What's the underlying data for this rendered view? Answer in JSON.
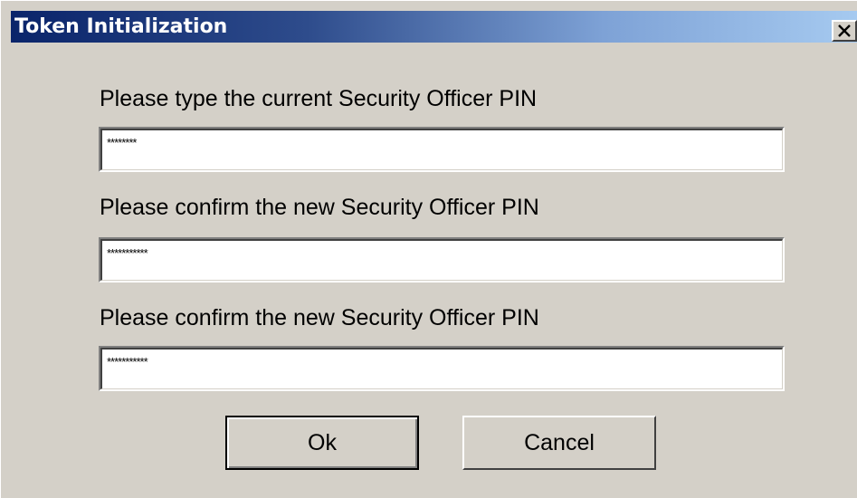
{
  "window": {
    "title": "Token Initialization",
    "close_label": "×"
  },
  "fields": [
    {
      "label": "Please type the current Security Officer PIN",
      "value": "********"
    },
    {
      "label": "Please confirm the new Security Officer PIN",
      "value": "***********"
    },
    {
      "label": "Please confirm the new Security Officer PIN",
      "value": "***********"
    }
  ],
  "buttons": {
    "ok_label": "Ok",
    "cancel_label": "Cancel"
  },
  "colors": {
    "titlebar_start": "#0a246a",
    "titlebar_end": "#a6caf0",
    "face": "#d4d0c8"
  }
}
